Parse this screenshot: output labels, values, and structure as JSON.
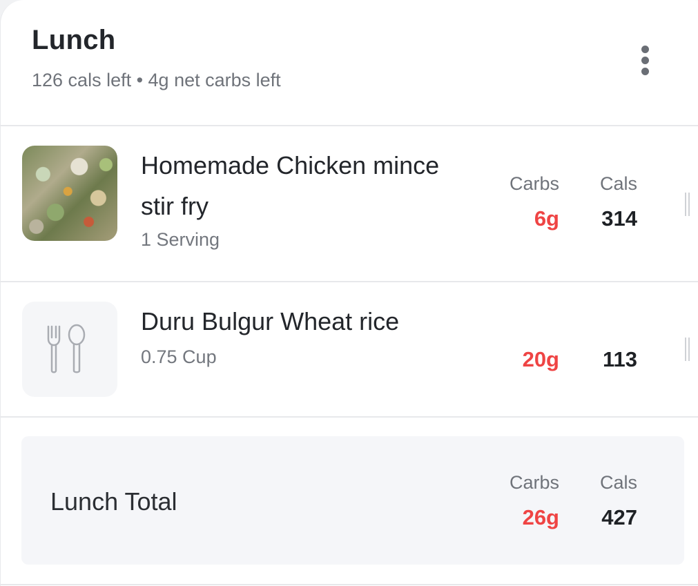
{
  "meal": {
    "title": "Lunch",
    "subtitle": "126 cals left • 4g net carbs left"
  },
  "columns": {
    "carbs_label": "Carbs",
    "cals_label": "Cals"
  },
  "items": [
    {
      "name": "Homemade Chicken mince stir fry",
      "serving": "1 Serving",
      "carbs": "6g",
      "cals": "314",
      "thumbnail": "food-photo"
    },
    {
      "name": "Duru Bulgur Wheat rice",
      "serving": "0.75 Cup",
      "carbs": "20g",
      "cals": "113",
      "thumbnail": "fork-spoon-placeholder-icon"
    }
  ],
  "total": {
    "label": "Lunch Total",
    "carbs": "26g",
    "cals": "427"
  },
  "colors": {
    "carbs": "#ef4444",
    "text": "#23262b",
    "muted": "#6f737a",
    "total_bg": "#f5f6f9"
  }
}
